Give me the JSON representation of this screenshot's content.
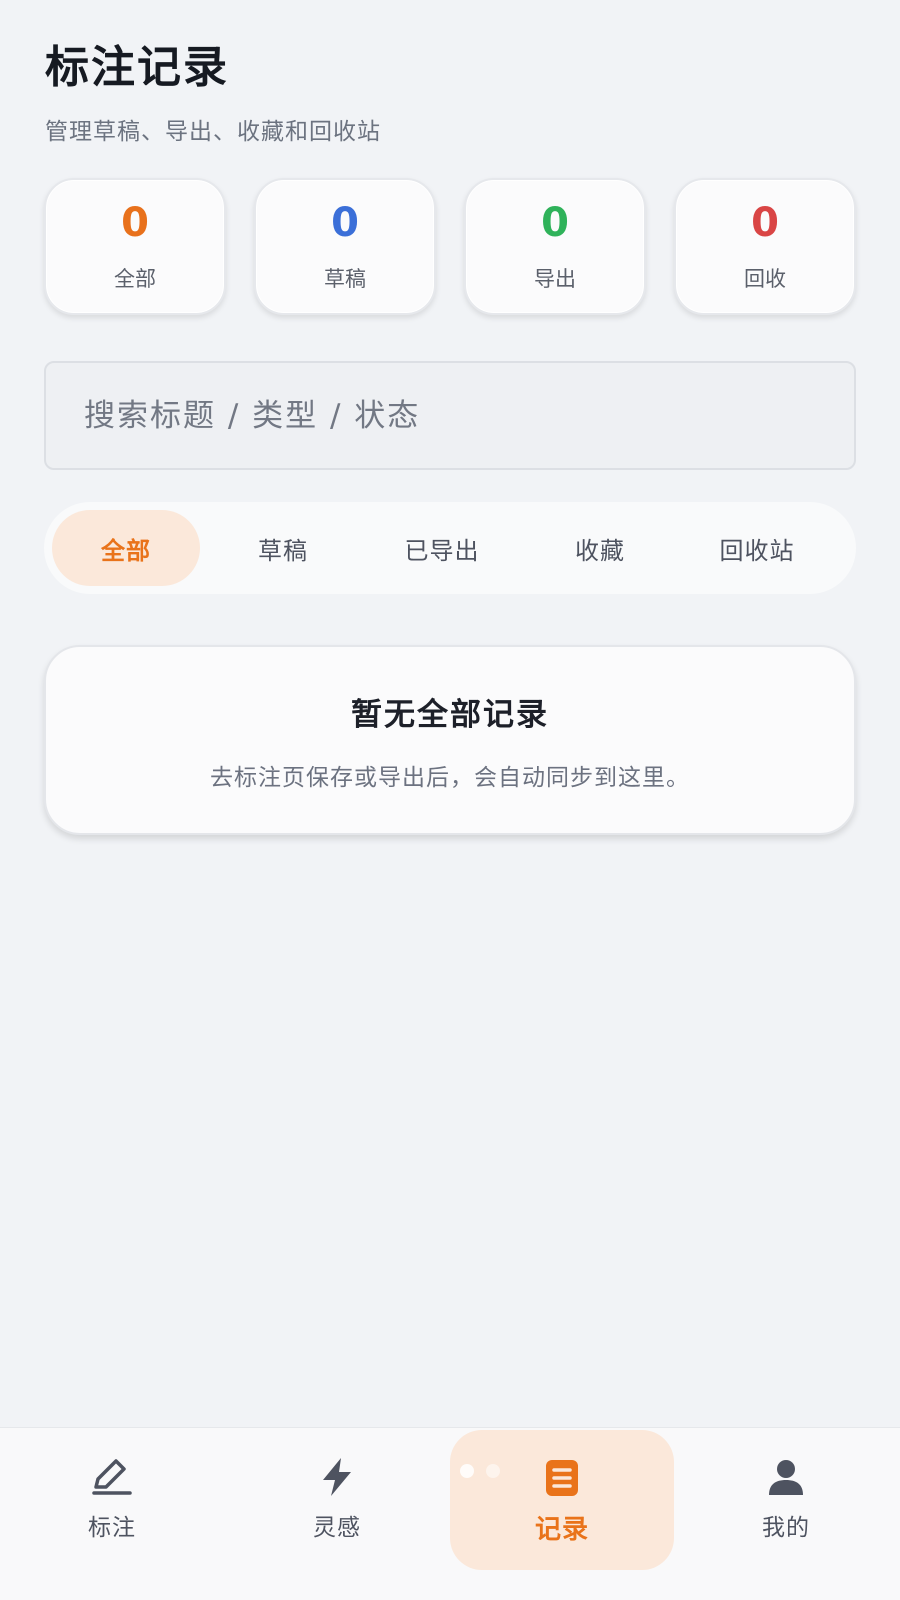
{
  "header": {
    "title": "标注记录",
    "subtitle": "管理草稿、导出、收藏和回收站"
  },
  "stats": [
    {
      "value": "0",
      "label": "全部",
      "color": "#e8711c"
    },
    {
      "value": "0",
      "label": "草稿",
      "color": "#3b6fd8"
    },
    {
      "value": "0",
      "label": "导出",
      "color": "#2fb25a"
    },
    {
      "value": "0",
      "label": "回收",
      "color": "#d94545"
    }
  ],
  "search": {
    "placeholder": "搜索标题 / 类型 / 状态",
    "value": ""
  },
  "tabs": [
    {
      "label": "全部",
      "active": true
    },
    {
      "label": "草稿",
      "active": false
    },
    {
      "label": "已导出",
      "active": false
    },
    {
      "label": "收藏",
      "active": false
    },
    {
      "label": "回收站",
      "active": false
    }
  ],
  "empty_state": {
    "title": "暂无全部记录",
    "description": "去标注页保存或导出后，会自动同步到这里。"
  },
  "bottom_nav": [
    {
      "label": "标注",
      "icon": "pencil-icon",
      "active": false
    },
    {
      "label": "灵感",
      "icon": "lightning-icon",
      "active": false
    },
    {
      "label": "记录",
      "icon": "list-icon",
      "active": true
    },
    {
      "label": "我的",
      "icon": "user-icon",
      "active": false
    }
  ],
  "colors": {
    "accent": "#e9731a",
    "accent_bg": "#fbe8da",
    "page_bg": "#f1f3f6"
  }
}
